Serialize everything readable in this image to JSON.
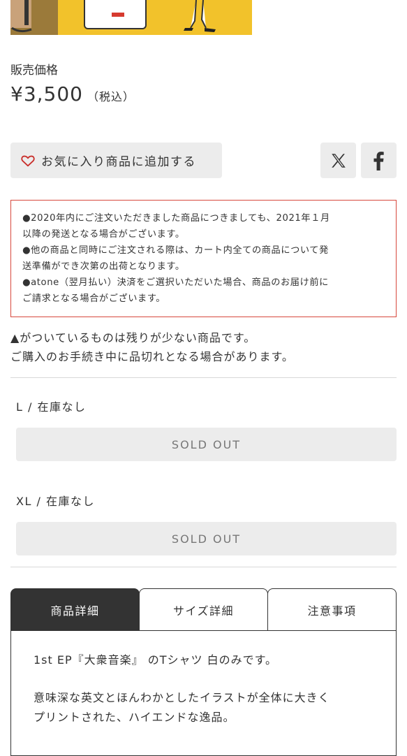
{
  "product": {
    "price_label": "販売価格",
    "price": "¥3,500",
    "tax_note": "（税込）"
  },
  "actions": {
    "favorite_label": "お気に入り商品に追加する",
    "share_x_icon": "x-logo-icon",
    "share_facebook_icon": "facebook-icon"
  },
  "notice": {
    "lines": [
      "●2020年内にご注文いただきました商品につきましても、2021年１月",
      "以降の発送となる場合がございます。",
      "●他の商品と同時にご注文される際は、カート内全ての商品について発",
      "送準備ができ次第の出荷となります。",
      "●atone（翌月払い）決済をご選択いただいた場合、商品のお届け前に",
      "ご請求となる場合がございます。"
    ]
  },
  "stock_note": {
    "line1": "▲がついているものは残りが少ない商品です。",
    "line2": "ご購入のお手続き中に品切れとなる場合があります。"
  },
  "variants": [
    {
      "label": "L / 在庫なし",
      "button": "SOLD OUT"
    },
    {
      "label": "XL / 在庫なし",
      "button": "SOLD OUT"
    }
  ],
  "tabs": [
    {
      "label": "商品詳細",
      "active": true
    },
    {
      "label": "サイズ詳細",
      "active": false
    },
    {
      "label": "注意事項",
      "active": false
    }
  ],
  "tab_content": {
    "line1": "1st EP『大衆音楽』 のTシャツ 白のみです。",
    "line2": "意味深な英文とほんわかとしたイラストが全体に大きく",
    "line3": "プリントされた、ハイエンドな逸品。"
  },
  "colors": {
    "accent_red": "#d7483c",
    "button_bg": "#ececec",
    "active_tab_bg": "#333333",
    "banner_yellow": "#f2c22b"
  }
}
